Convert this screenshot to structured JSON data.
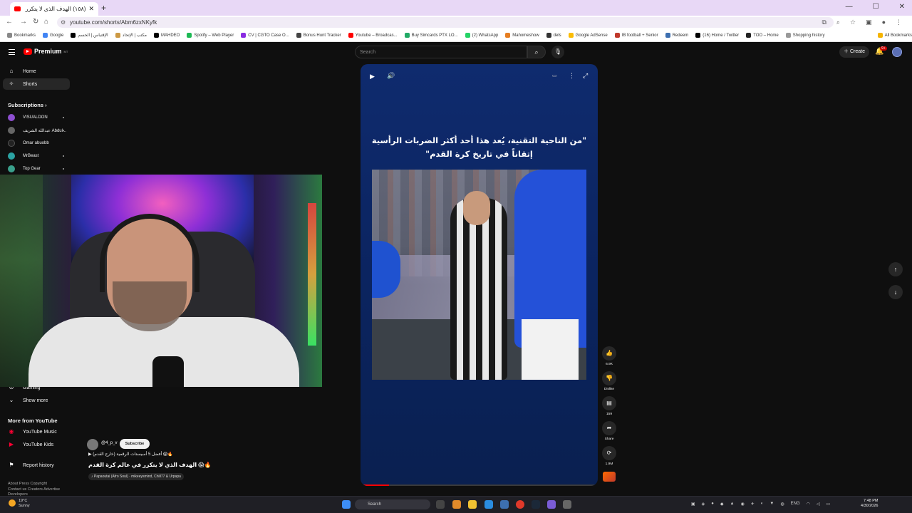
{
  "browser": {
    "tab_title": "(١٥٨) الهدف الذي لا يتكرر في ...",
    "url": "youtube.com/shorts/Abm6zxNKyfk",
    "bookmarks": [
      "Bookmarks",
      "Google",
      "الإقتباس | الحسم",
      "مكتب | الإتحاد",
      "MAHDEO",
      "Spotify – Web Player",
      "CV | CGTO Case O...",
      "Bonus Hunt Tracker",
      "Youtube – Broadcas...",
      "Buy Simcards PTX LO...",
      "(2) WhatsApp",
      "Mahomeshow",
      "dels",
      "Google AdSense",
      "IB football + Senior",
      "Redeem",
      "(16) Home / Twitter",
      "TOO – Home",
      "Shopping history",
      "All Bookmarks"
    ]
  },
  "youtube": {
    "logo_text": "Premium",
    "logo_sup": "MT",
    "search_placeholder": "Search",
    "create_label": "Create",
    "notif_count": "9+",
    "sidebar": {
      "home": "Home",
      "shorts": "Shorts",
      "subscriptions_heading": "Subscriptions",
      "subscriptions": [
        "VISUALDON",
        "عبدالله الشريف Abdul...",
        "Omar abuobb",
        "MrBeast",
        "Top Gear"
      ],
      "gaming": "Gaming",
      "show_more": "Show more",
      "more_heading": "More from YouTube",
      "youtube_music": "YouTube Music",
      "youtube_kids": "YouTube Kids",
      "report_history": "Report history",
      "footer1": "About  Press  Copyright",
      "footer2": "Contact us  Creators  Advertise",
      "footer3": "Developers"
    },
    "short": {
      "caption_line1": "\"من الناحية التقنية، يُعد هذا أحد أكثر الضربات الرأسية",
      "caption_line2": "إتقاناً في تاريخ كرة القدم\"",
      "progress": 0.12
    },
    "actions": {
      "like": "6.9K",
      "dislike": "Dislike",
      "comments": "159",
      "share": "Share",
      "remix": "1.9M"
    },
    "channel": {
      "handle": "@4_p_v",
      "subscribe": "Subscribe",
      "desc_line1": "▶ أفضل 5 أسيستات الرقمية (خارج القدم) 😱🔥",
      "desc_line2": "الهدف الذي لا يتكرر في عالم كرة القدم 😱🔥",
      "music": "♪ Papaoutai (Afro Soul) · mikeeysmind, Chill77 & Urpapa"
    }
  },
  "taskbar": {
    "temp": "19°C",
    "condition": "Sunny",
    "search": "Search",
    "lang": "ENG",
    "time": "7:48 PM",
    "date": "4/30/2026"
  },
  "colors": {
    "yt_red": "#ff0000",
    "player_bg": "#0f2b6e",
    "page_bg": "#0f0f0f"
  }
}
